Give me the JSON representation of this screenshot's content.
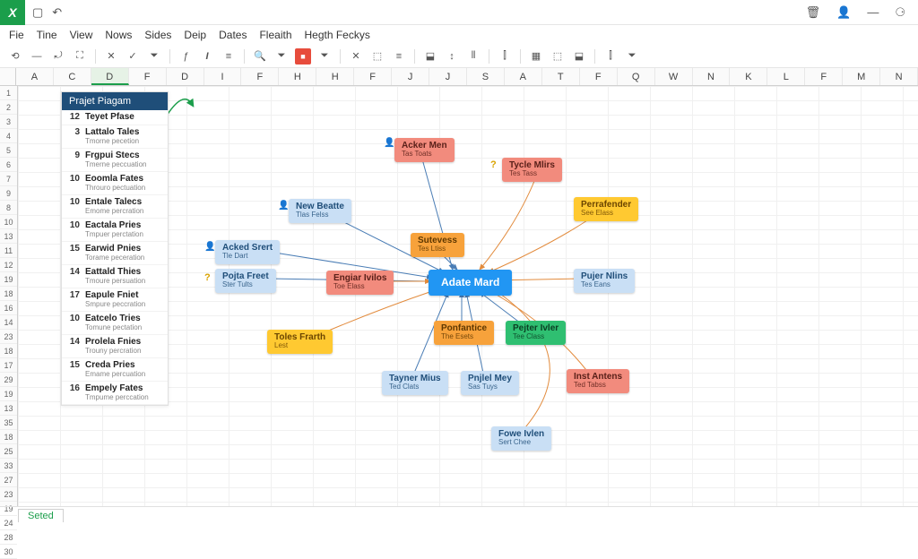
{
  "app": {
    "icon_glyph": "X"
  },
  "title_controls": {
    "save": "▢",
    "undo": "↶",
    "trash": "🗑",
    "user": "👤",
    "min": "—",
    "acct": "⚆"
  },
  "menu": [
    "Fie",
    "Tine",
    "View",
    "Nows",
    "Sides",
    "Deip",
    "Dates",
    "Fleaith",
    "Hegth Feckys"
  ],
  "toolbar": [
    "⟲",
    "—",
    "⤾",
    "⛶",
    "|",
    "✕",
    "✓",
    "⏷",
    "|",
    "ƒ",
    "I",
    "≡",
    "|",
    "🔍",
    "⏷",
    "■",
    "⏷",
    "|",
    "✕",
    "⬚",
    "≡",
    "|",
    "⬓",
    "↕",
    "⫴",
    "|",
    "⫿",
    "|",
    "▦",
    "⬚",
    "⬓",
    "|",
    "⫿",
    "⏷"
  ],
  "columns": [
    "A",
    "C",
    "D",
    "F",
    "D",
    "I",
    "F",
    "H",
    "H",
    "F",
    "J",
    "J",
    "S",
    "A",
    "T",
    "F",
    "Q",
    "W",
    "N",
    "K",
    "L",
    "F",
    "M",
    "N"
  ],
  "sel_col_index": 2,
  "rows": [
    "1",
    "2",
    "3",
    "4",
    "5",
    "6",
    "7",
    "9",
    "8",
    "10",
    "13",
    "11",
    "12",
    "19",
    "18",
    "16",
    "14",
    "23",
    "18",
    "17",
    "29",
    "19",
    "13",
    "35",
    "18",
    "25",
    "33",
    "27",
    "23",
    "19",
    "24",
    "28",
    "30"
  ],
  "panel": {
    "title": "Prajet Piagam",
    "items": [
      {
        "n": "12",
        "t": "Teyet Pfase",
        "s": ""
      },
      {
        "n": "3",
        "t": "Lattalo Tales",
        "s": "Tmorne pecetion"
      },
      {
        "n": "9",
        "t": "Frgpui Stecs",
        "s": "Tmerne peccuation"
      },
      {
        "n": "10",
        "t": "Eoomla Fates",
        "s": "Throuro pectuation"
      },
      {
        "n": "10",
        "t": "Entale Talecs",
        "s": "Emome percration"
      },
      {
        "n": "10",
        "t": "Eactala Pries",
        "s": "Tmpuer perctation"
      },
      {
        "n": "15",
        "t": "Earwid Pnies",
        "s": "Torame peceration"
      },
      {
        "n": "14",
        "t": "Eattald Thies",
        "s": "Tmoure persuation"
      },
      {
        "n": "17",
        "t": "Eapule Fniet",
        "s": "Smpure peccration"
      },
      {
        "n": "10",
        "t": "Eatcelo Tries",
        "s": "Tomune pectation"
      },
      {
        "n": "14",
        "t": "Prolela Fnies",
        "s": "Trouny percration"
      },
      {
        "n": "15",
        "t": "Creda Pries",
        "s": "Emame percuation"
      },
      {
        "n": "16",
        "t": "Empely Fates",
        "s": "Tmpume perccation"
      }
    ]
  },
  "nodes": {
    "center": {
      "t": "Adate Mard"
    },
    "acker_men": {
      "t": "Acker Men",
      "s": "Tas Toats"
    },
    "tycle_mirs": {
      "t": "Tycle Mlirs",
      "s": "Tes Tass"
    },
    "new_beatte": {
      "t": "New Beatte",
      "s": "Tlas Felss"
    },
    "perrafender": {
      "t": "Perrafender",
      "s": "See Elass"
    },
    "acked_srert": {
      "t": "Acked Srert",
      "s": "Tle Dart"
    },
    "sutevess": {
      "t": "Sutevess",
      "s": "Tes Ltiss"
    },
    "pojta_freet": {
      "t": "Pojta Freet",
      "s": "Ster Tults"
    },
    "engiar_ivlos": {
      "t": "Engiar Ivilos",
      "s": "Toe Elass"
    },
    "pujer_mirs": {
      "t": "Pujer Nlins",
      "s": "Tes Eans"
    },
    "toles_frarth": {
      "t": "Toles Frarth",
      "s": "Lest"
    },
    "ponfantice": {
      "t": "Ponfantice",
      "s": "The Esets"
    },
    "pejter_ivler": {
      "t": "Pejter Ivler",
      "s": "Tee Class"
    },
    "tayner_mius": {
      "t": "Tayner Mius",
      "s": "Ted Clats"
    },
    "pnjlel_mey": {
      "t": "Pnjlel Mey",
      "s": "Sas Tuys"
    },
    "inst_antens": {
      "t": "Inst Antens",
      "s": "Ted Tabss"
    },
    "fowe_ivlen": {
      "t": "Fowe Ivlen",
      "s": "Sert Chee"
    }
  },
  "status": {
    "tab": "Seted"
  },
  "chart_data": {
    "type": "network-diagram",
    "title": "Prajet Piagam",
    "center": "Adate Mard",
    "nodes": [
      {
        "id": "acker_men",
        "label": "Acker Men",
        "sub": "Tas Toats",
        "color": "salmon",
        "icon": "user"
      },
      {
        "id": "tycle_mirs",
        "label": "Tycle Mlirs",
        "sub": "Tes Tass",
        "color": "salmon",
        "icon": "question"
      },
      {
        "id": "new_beatte",
        "label": "New Beatte",
        "sub": "Tlas Felss",
        "color": "blue",
        "icon": "user"
      },
      {
        "id": "perrafender",
        "label": "Perrafender",
        "sub": "See Elass",
        "color": "yellow"
      },
      {
        "id": "acked_srert",
        "label": "Acked Srert",
        "sub": "Tle Dart",
        "color": "blue",
        "icon": "user"
      },
      {
        "id": "sutevess",
        "label": "Sutevess",
        "sub": "Tes Ltiss",
        "color": "orange"
      },
      {
        "id": "pojta_freet",
        "label": "Pojta Freet",
        "sub": "Ster Tults",
        "color": "blue",
        "icon": "question"
      },
      {
        "id": "engiar_ivlos",
        "label": "Engiar Ivilos",
        "sub": "Toe Elass",
        "color": "salmon"
      },
      {
        "id": "pujer_mirs",
        "label": "Pujer Nlins",
        "sub": "Tes Eans",
        "color": "blue"
      },
      {
        "id": "toles_frarth",
        "label": "Toles Frarth",
        "sub": "Lest",
        "color": "yellow"
      },
      {
        "id": "ponfantice",
        "label": "Ponfantice",
        "sub": "The Esets",
        "color": "orange"
      },
      {
        "id": "pejter_ivler",
        "label": "Pejter Ivler",
        "sub": "Tee Class",
        "color": "green"
      },
      {
        "id": "tayner_mius",
        "label": "Tayner Mius",
        "sub": "Ted Clats",
        "color": "blue"
      },
      {
        "id": "pnjlel_mey",
        "label": "Pnjlel Mey",
        "sub": "Sas Tuys",
        "color": "blue"
      },
      {
        "id": "inst_antens",
        "label": "Inst Antens",
        "sub": "Ted Tabss",
        "color": "salmon"
      },
      {
        "id": "fowe_ivlen",
        "label": "Fowe Ivlen",
        "sub": "Sert Chee",
        "color": "blue"
      }
    ],
    "edges_to_center": [
      "acker_men",
      "tycle_mirs",
      "new_beatte",
      "perrafender",
      "acked_srert",
      "sutevess",
      "pojta_freet",
      "engiar_ivlos",
      "pujer_mirs",
      "toles_frarth",
      "ponfantice",
      "pejter_ivler",
      "tayner_mius",
      "pnjlel_mey",
      "inst_antens",
      "fowe_ivlen"
    ]
  }
}
